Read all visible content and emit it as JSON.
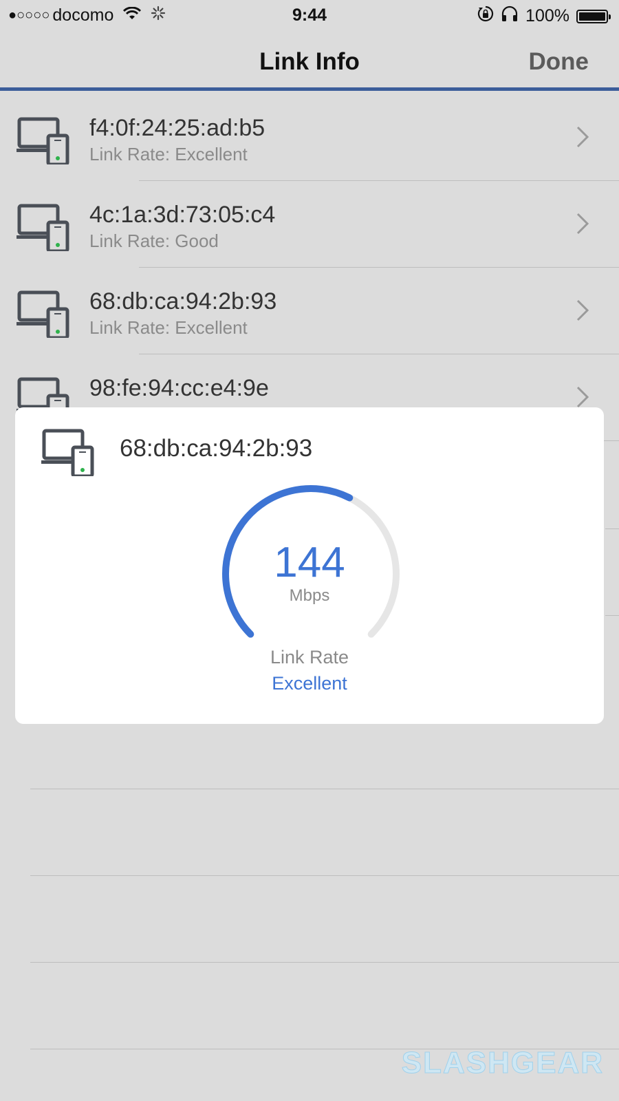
{
  "status_bar": {
    "signal_dots": "●○○○○",
    "carrier": "docomo",
    "time": "9:44",
    "battery": "100%",
    "icons": [
      "wifi-icon",
      "activity-spinner-icon",
      "rotation-lock-icon",
      "headphones-icon",
      "battery-icon"
    ]
  },
  "nav": {
    "title": "Link Info",
    "done_label": "Done"
  },
  "devices": [
    {
      "mac": "f4:0f:24:25:ad:b5",
      "rate": "Link Rate: Excellent"
    },
    {
      "mac": "4c:1a:3d:73:05:c4",
      "rate": "Link Rate: Good"
    },
    {
      "mac": "68:db:ca:94:2b:93",
      "rate": "Link Rate: Excellent"
    },
    {
      "mac": "98:fe:94:cc:e4:9e",
      "rate": ""
    }
  ],
  "popup": {
    "mac": "68:db:ca:94:2b:93",
    "speed_value": "144",
    "speed_unit": "Mbps",
    "gauge_fraction": 0.6,
    "rate_label": "Link Rate",
    "rate_quality": "Excellent"
  },
  "watermark": "SLASHGEAR",
  "colors": {
    "accent": "#3d74d4",
    "nav_border": "#3b5d9a",
    "background": "#dcdcdc",
    "icon": "#4a4f57",
    "icon_dot": "#2fb24c"
  }
}
